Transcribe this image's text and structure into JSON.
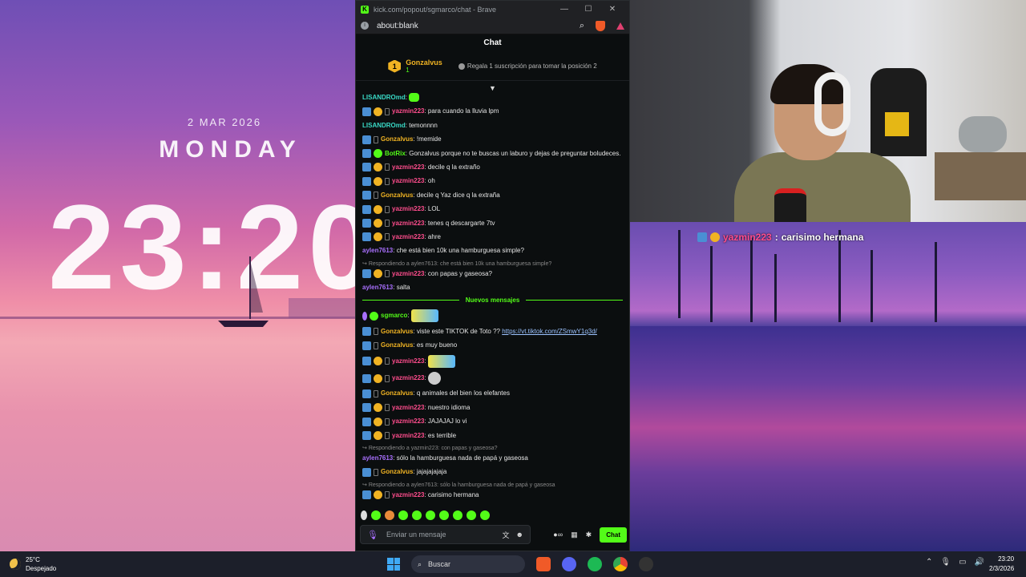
{
  "wallpaper": {
    "date": "2 MAR 2026",
    "day": "MONDAY",
    "time": "23:20"
  },
  "browser": {
    "window_title": "kick.com/popout/sgmarco/chat - Brave",
    "url": "about:blank",
    "chat_header": "Chat",
    "pinned": {
      "rank": "1",
      "name": "Gonzalvus",
      "count": "1",
      "gift_text": "Regala 1 suscripción para tomar la posición 2"
    }
  },
  "colors": {
    "kick_green": "#53fc18",
    "gold": "#f0b323",
    "pink": "#ff4d8d",
    "teal": "#39d9c6",
    "purple": "#a970ff"
  },
  "chat": {
    "m1": {
      "user": "LISANDROmd",
      "text": ""
    },
    "m2": {
      "user": "yazmin223",
      "text": "para cuando la lluvia lpm"
    },
    "m3": {
      "user": "LISANDROmd",
      "text": "temonnnn"
    },
    "m4": {
      "user": "Gonzalvus",
      "text": "!memide"
    },
    "m5": {
      "user": "BotRix",
      "text": "Gonzalvus porque no te buscas un laburo y dejas de preguntar boludeces."
    },
    "m6": {
      "user": "yazmin223",
      "text": "decile q la extraño"
    },
    "m7": {
      "user": "yazmin223",
      "text": "oh"
    },
    "m8": {
      "user": "Gonzalvus",
      "text": "decile q Yaz dice q la extraña"
    },
    "m9": {
      "user": "yazmin223",
      "text": "LOL"
    },
    "m10": {
      "user": "yazmin223",
      "text": "tenes q descargarte 7tv"
    },
    "m11": {
      "user": "yazmin223",
      "text": "ahre"
    },
    "m12": {
      "user": "aylen7613",
      "text": "che está bien 10k una hamburguesa simple?"
    },
    "r13": "Respondiendo a aylen7613: che está bien 10k una hamburguesa simple?",
    "m13": {
      "user": "yazmin223",
      "text": "con papas y gaseosa?"
    },
    "m14": {
      "user": "aylen7613",
      "text": "salta"
    },
    "divider": "Nuevos mensajes",
    "m15": {
      "user": "sgmarco",
      "text": ""
    },
    "m16": {
      "user": "Gonzalvus",
      "text": "viste este TIKTOK de Toto ?? ",
      "link": "https://vt.tiktok.com/ZSmwY1q3d/"
    },
    "m17": {
      "user": "Gonzalvus",
      "text": "es muy bueno"
    },
    "m18": {
      "user": "yazmin223",
      "text": ""
    },
    "m19": {
      "user": "yazmin223",
      "text": ""
    },
    "m20": {
      "user": "Gonzalvus",
      "text": "q animales del bien los elefantes"
    },
    "m21": {
      "user": "yazmin223",
      "text": "nuestro idioma"
    },
    "m22": {
      "user": "yazmin223",
      "text": "JAJAJAJ lo vi"
    },
    "m23": {
      "user": "yazmin223",
      "text": "es terrible"
    },
    "r24": "Respondiendo a yazmin223: con papas y gaseosa?",
    "m24": {
      "user": "aylen7613",
      "text": "sólo la hamburguesa nada de papá y gaseosa"
    },
    "m25": {
      "user": "Gonzalvus",
      "text": "jajajajajaja"
    },
    "r26": "Respondiendo a aylen7613: sólo la hamburguesa nada de papá y gaseosa",
    "m26": {
      "user": "yazmin223",
      "text": "carisimo hermana"
    }
  },
  "composer": {
    "placeholder": "Enviar un mensaje",
    "send_label": "Chat"
  },
  "overlay": {
    "user": "yazmin223",
    "text": "carisimo hermana"
  },
  "taskbar": {
    "temperature": "25°C",
    "weather": "Despejado",
    "search_label": "Buscar",
    "time": "23:20",
    "date": "2/3/2026"
  }
}
